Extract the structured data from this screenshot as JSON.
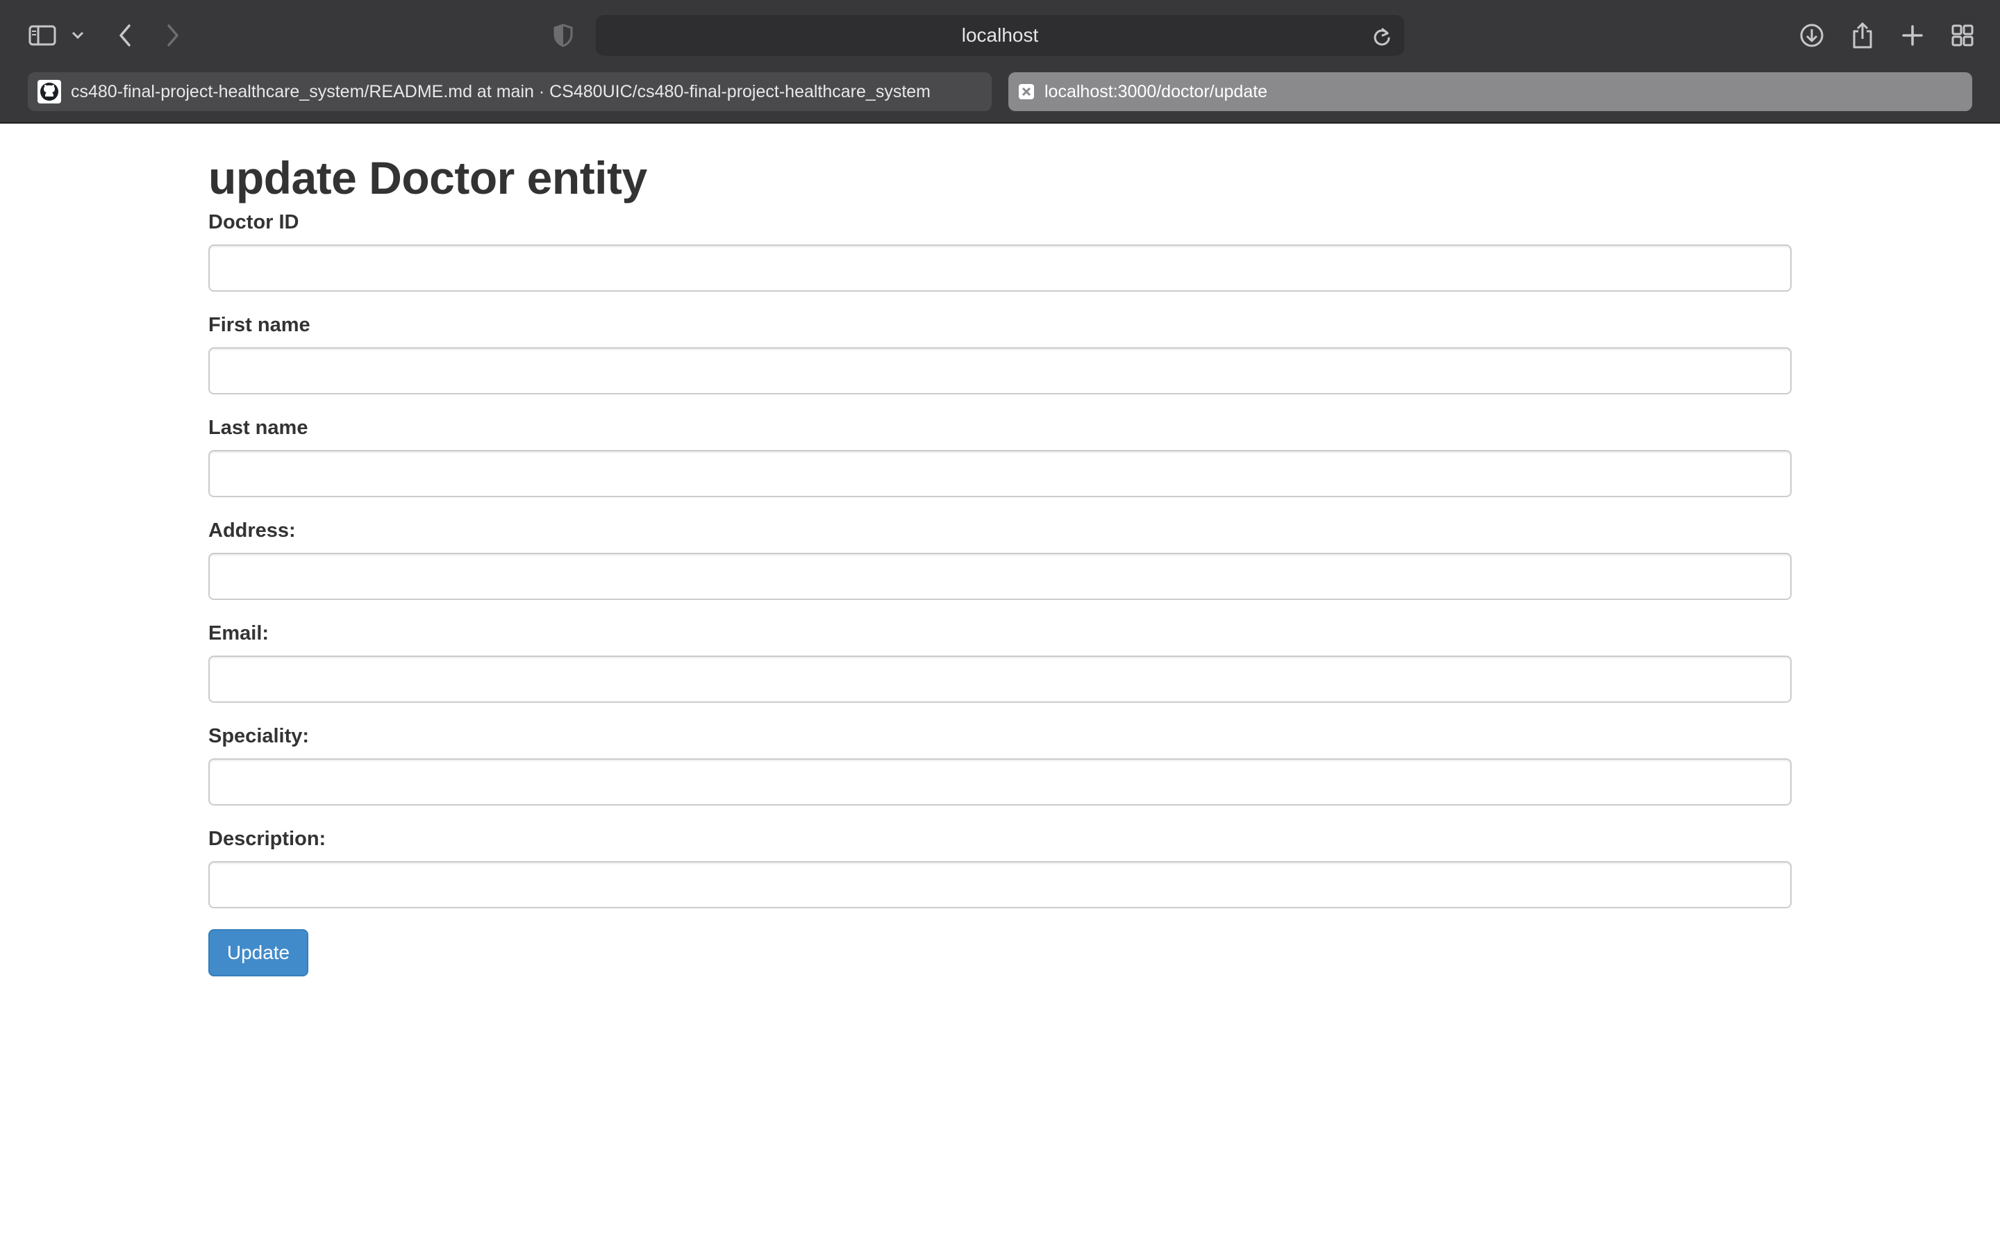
{
  "browser": {
    "address": "localhost",
    "tabs": [
      {
        "label": "cs480-final-project-healthcare_system/README.md at main · CS480UIC/cs480-final-project-healthcare_system",
        "favicon": "github-icon",
        "active": false
      },
      {
        "label": "localhost:3000/doctor/update",
        "favicon": "page-close-icon",
        "active": true
      }
    ],
    "toolbar_icons": [
      "sidebar-icon",
      "chevron-down-icon",
      "back-icon",
      "forward-icon",
      "privacy-shield-icon",
      "reload-icon",
      "download-icon",
      "share-icon",
      "new-tab-icon",
      "tab-overview-icon"
    ]
  },
  "form": {
    "title": "update Doctor entity",
    "fields": [
      {
        "label": "Doctor ID",
        "value": "",
        "placeholder": ""
      },
      {
        "label": "First name",
        "value": "",
        "placeholder": ""
      },
      {
        "label": "Last name",
        "value": "",
        "placeholder": ""
      },
      {
        "label": "Address:",
        "value": "",
        "placeholder": ""
      },
      {
        "label": "Email:",
        "value": "",
        "placeholder": ""
      },
      {
        "label": "Speciality:",
        "value": "",
        "placeholder": ""
      },
      {
        "label": "Description:",
        "value": "",
        "placeholder": ""
      }
    ],
    "submit_label": "Update"
  },
  "colors": {
    "chrome_bg": "#38383a",
    "active_tab": "#8a8a8d",
    "button_primary": "#428bca",
    "text": "#333333"
  }
}
